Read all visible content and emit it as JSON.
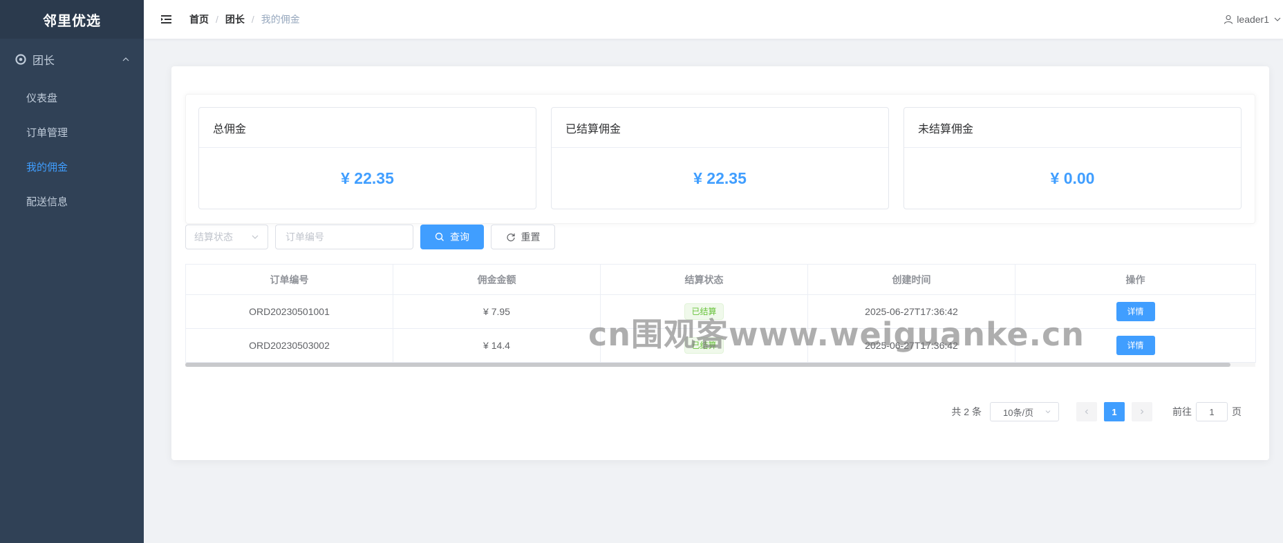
{
  "app": {
    "logo": "邻里优选"
  },
  "sidebar": {
    "parent": {
      "label": "团长",
      "icon": "gear-icon"
    },
    "items": [
      {
        "label": "仪表盘",
        "active": false
      },
      {
        "label": "订单管理",
        "active": false
      },
      {
        "label": "我的佣金",
        "active": true
      },
      {
        "label": "配送信息",
        "active": false
      }
    ]
  },
  "navbar": {
    "breadcrumb": [
      "首页",
      "团长",
      "我的佣金"
    ],
    "user": "leader1"
  },
  "stats": [
    {
      "title": "总佣金",
      "value": "¥ 22.35"
    },
    {
      "title": "已结算佣金",
      "value": "¥ 22.35"
    },
    {
      "title": "未结算佣金",
      "value": "¥ 0.00"
    }
  ],
  "filters": {
    "status_placeholder": "结算状态",
    "order_placeholder": "订单编号",
    "search_label": "查询",
    "reset_label": "重置"
  },
  "table": {
    "columns": [
      "订单编号",
      "佣金金额",
      "结算状态",
      "创建时间",
      "操作"
    ],
    "rows": [
      {
        "order_no": "ORD20230501001",
        "amount": "¥ 7.95",
        "status": "已结算",
        "created": "2025-06-27T17:36:42",
        "action": "详情"
      },
      {
        "order_no": "ORD20230503002",
        "amount": "¥ 14.4",
        "status": "已结算",
        "created": "2025-06-27T17:36:42",
        "action": "详情"
      }
    ]
  },
  "pagination": {
    "total": "共 2 条",
    "page_size": "10条/页",
    "current": "1",
    "goto_prefix": "前往",
    "goto_value": "1",
    "goto_suffix": "页"
  },
  "watermark": "cn围观客www.weiguanke.cn",
  "colors": {
    "accent": "#409eff",
    "sidebar": "#304156",
    "success": "#67c23a"
  }
}
